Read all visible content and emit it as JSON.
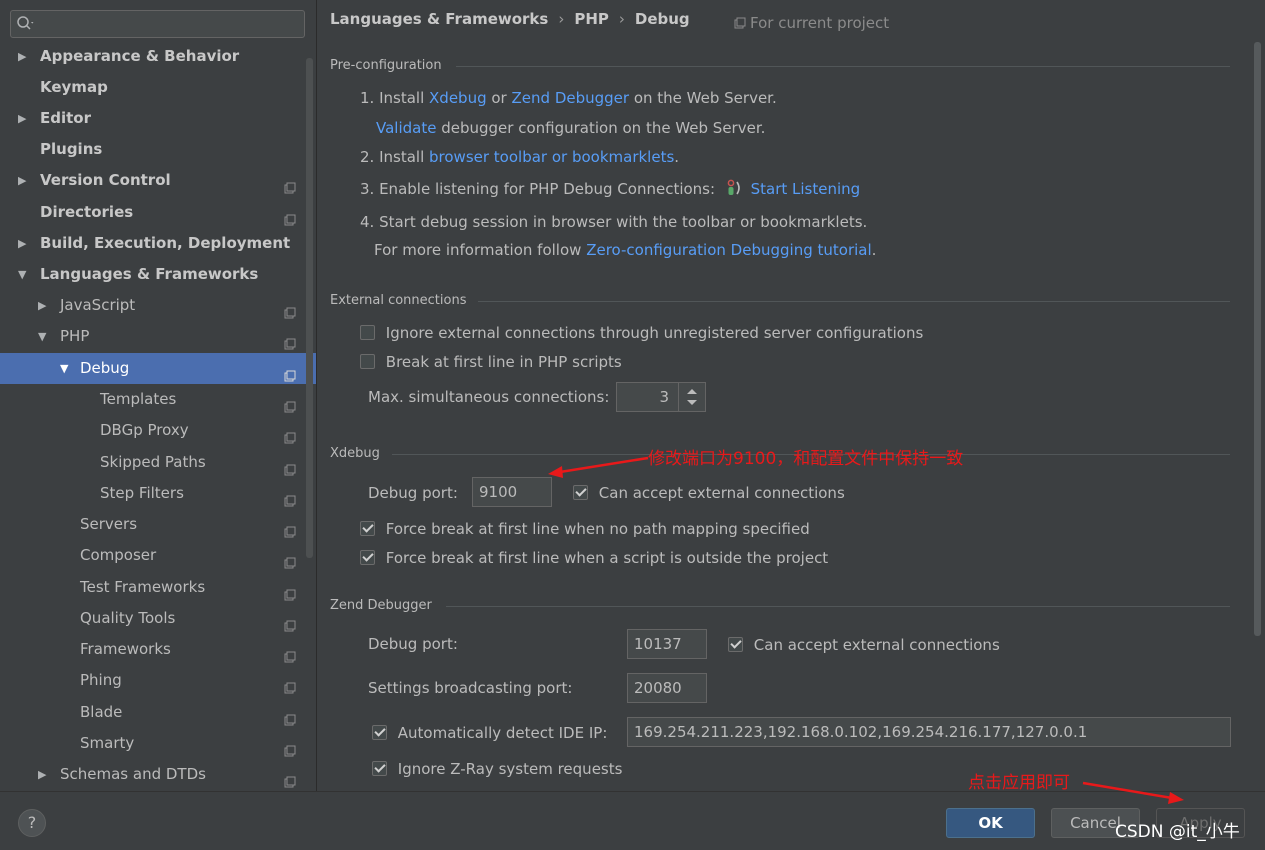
{
  "sidebar": {
    "search": {
      "value": "",
      "placeholder": ""
    },
    "items": [
      {
        "label": "Appearance & Behavior",
        "bold": true
      },
      {
        "label": "Keymap",
        "bold": true
      },
      {
        "label": "Editor",
        "bold": true
      },
      {
        "label": "Plugins",
        "bold": true
      },
      {
        "label": "Version Control",
        "bold": true
      },
      {
        "label": "Directories",
        "bold": true
      },
      {
        "label": "Build, Execution, Deployment",
        "bold": true
      },
      {
        "label": "Languages & Frameworks",
        "bold": true
      },
      {
        "label": "JavaScript"
      },
      {
        "label": "PHP"
      },
      {
        "label": "Debug",
        "selected": true
      },
      {
        "label": "Templates"
      },
      {
        "label": "DBGp Proxy"
      },
      {
        "label": "Skipped Paths"
      },
      {
        "label": "Step Filters"
      },
      {
        "label": "Servers"
      },
      {
        "label": "Composer"
      },
      {
        "label": "Test Frameworks"
      },
      {
        "label": "Quality Tools"
      },
      {
        "label": "Frameworks"
      },
      {
        "label": "Phing"
      },
      {
        "label": "Blade"
      },
      {
        "label": "Smarty"
      },
      {
        "label": "Schemas and DTDs"
      }
    ]
  },
  "header": {
    "breadcrumb": [
      "Languages & Frameworks",
      "PHP",
      "Debug"
    ],
    "breadcrumb_sep": "›",
    "scope": "For current project"
  },
  "preconfig": {
    "title": "Pre-configuration",
    "step1_prefix": "1. Install",
    "step1_link1": "Xdebug",
    "step1_or": "or",
    "step1_link2": "Zend Debugger",
    "step1_suffix": "on the Web Server.",
    "validate_link": "Validate",
    "validate_suffix": "debugger configuration on the Web Server.",
    "step2_prefix": "2. Install",
    "step2_link": "browser toolbar or bookmarklets",
    "step2_suffix": ".",
    "step3_prefix": "3. Enable listening for PHP Debug Connections:",
    "step3_link": "Start Listening",
    "step4": "4. Start debug session in browser with the toolbar or bookmarklets.",
    "more_prefix": "For more information follow",
    "more_link": "Zero-configuration Debugging tutorial",
    "more_suffix": "."
  },
  "external": {
    "title": "External connections",
    "ignore_label": "Ignore external connections through unregistered server configurations",
    "ignore_checked": false,
    "break_label": "Break at first line in PHP scripts",
    "break_checked": false,
    "max_label": "Max. simultaneous connections:",
    "max_value": "3"
  },
  "xdebug": {
    "title": "Xdebug",
    "port_label": "Debug port:",
    "port_value": "9100",
    "accept_label": "Can accept external connections",
    "accept_checked": true,
    "force1_label": "Force break at first line when no path mapping specified",
    "force1_checked": true,
    "force2_label": "Force break at first line when a script is outside the project",
    "force2_checked": true
  },
  "zend": {
    "title": "Zend Debugger",
    "port_label": "Debug port:",
    "port_value": "10137",
    "accept_label": "Can accept external connections",
    "accept_checked": true,
    "broadcast_label": "Settings broadcasting port:",
    "broadcast_value": "20080",
    "autodetect_label": "Automatically detect IDE IP:",
    "autodetect_checked": true,
    "ip_value": "169.254.211.223,192.168.0.102,169.254.216.177,127.0.0.1",
    "zray_label": "Ignore Z-Ray system requests",
    "zray_checked": true
  },
  "annotations": {
    "port_note": "修改端口为9100，和配置文件中保持一致",
    "apply_note": "点击应用即可",
    "color": "#e8191a"
  },
  "buttons": {
    "help": "?",
    "ok": "OK",
    "cancel": "Cancel",
    "apply": "Apply"
  },
  "watermark": "CSDN @it_小牛",
  "colors": {
    "background": "#3c3f41",
    "selection": "#4b6eaf",
    "link": "#589df6",
    "ok_button": "#365880"
  }
}
